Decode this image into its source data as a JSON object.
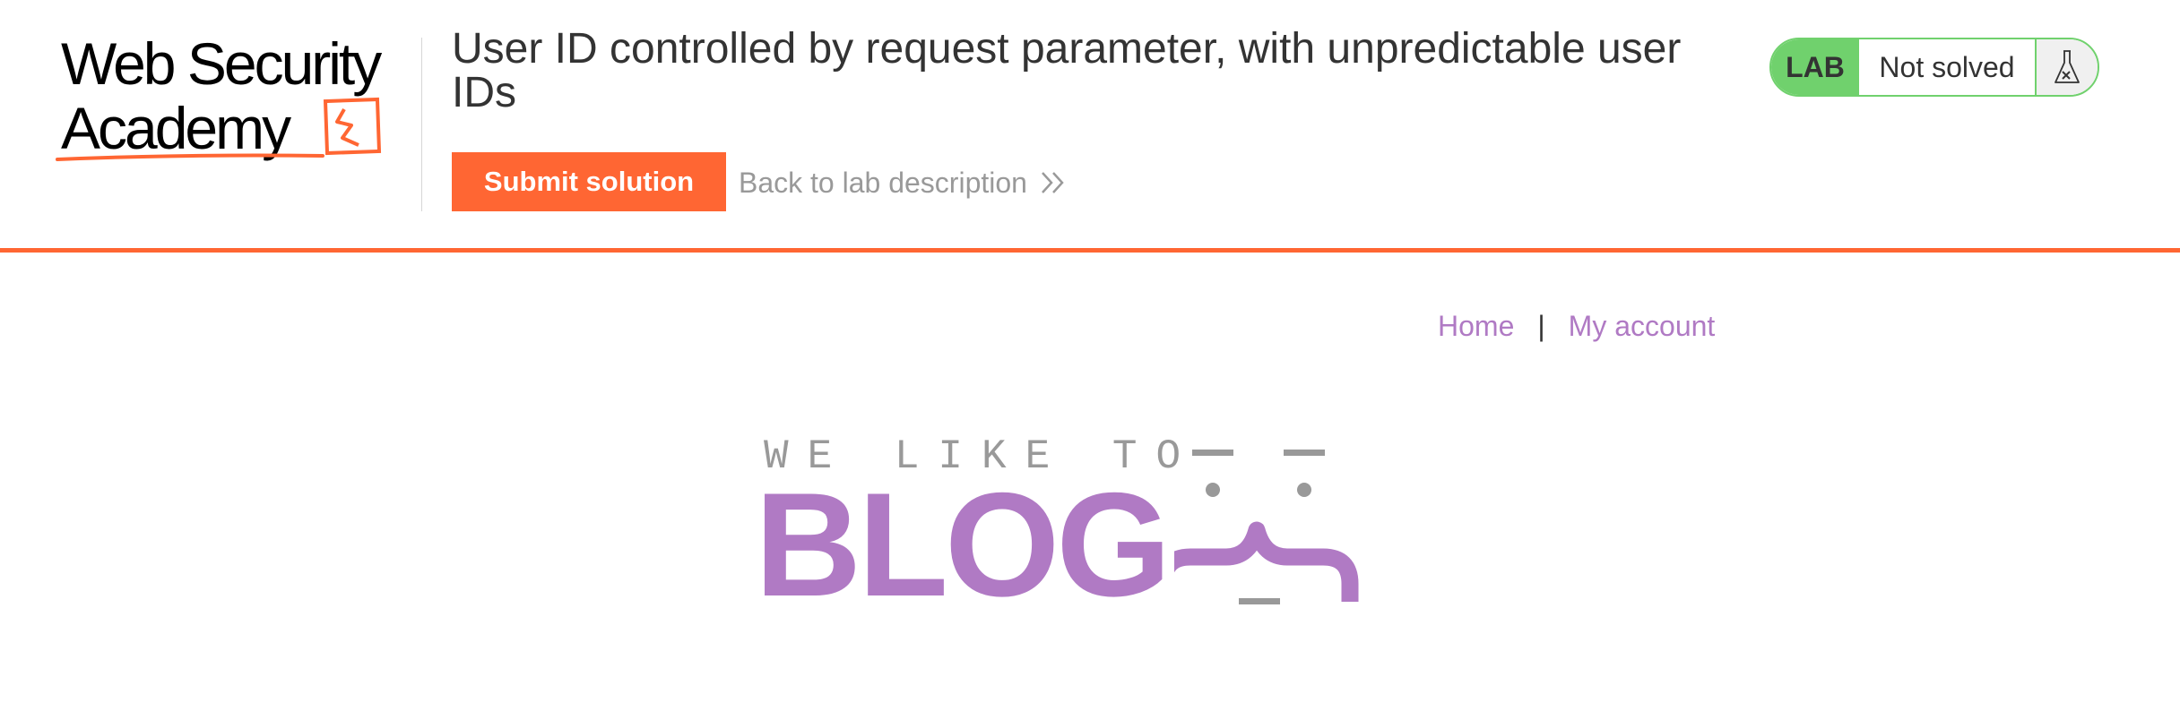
{
  "header": {
    "logo": {
      "line1": "Web Security",
      "line2": "Academy"
    },
    "lab_title": "User ID controlled by request parameter, with unpredictable user IDs",
    "submit_label": "Submit solution",
    "back_link_label": "Back to lab description",
    "lab_badge": {
      "label": "LAB",
      "status": "Not solved"
    },
    "icons": {
      "back": "double-chevron-right-icon",
      "flask": "flask-icon"
    }
  },
  "nav": {
    "home_label": "Home",
    "separator": "|",
    "account_label": "My account"
  },
  "banner": {
    "tagline": "WE LIKE TO",
    "title": "BLOG"
  },
  "colors": {
    "accent": "#ff6633",
    "brand_purple": "#b07ac4",
    "lab_green": "#70d16d",
    "muted_gray": "#999999",
    "text": "#333333"
  }
}
